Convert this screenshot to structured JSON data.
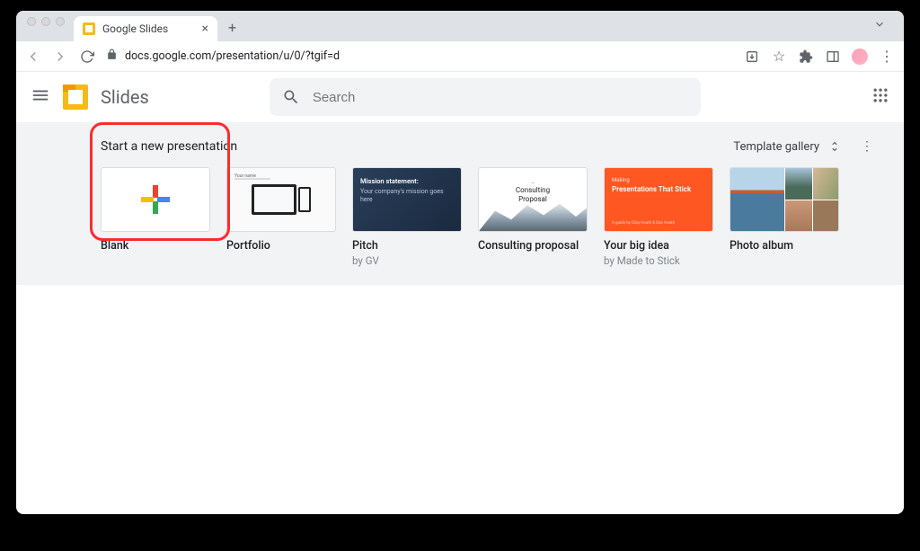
{
  "browser": {
    "tab_title": "Google Slides",
    "url": "docs.google.com/presentation/u/0/?tgif=d"
  },
  "app": {
    "name": "Slides",
    "search_placeholder": "Search"
  },
  "section": {
    "title": "Start a new presentation",
    "gallery_label": "Template gallery"
  },
  "templates": [
    {
      "title": "Blank",
      "sub": ""
    },
    {
      "title": "Portfolio",
      "sub": ""
    },
    {
      "title": "Pitch",
      "sub": "by GV",
      "thumb_line1": "Mission statement:",
      "thumb_line2": "Your company's mission goes here"
    },
    {
      "title": "Consulting proposal",
      "sub": "",
      "thumb_line1": "Consulting",
      "thumb_line2": "Proposal"
    },
    {
      "title": "Your big idea",
      "sub": "by Made to Stick",
      "thumb_tag": "Making",
      "thumb_line1": "Presentations That Stick",
      "thumb_byline": "A guide by Chip Heath & Dan Heath"
    },
    {
      "title": "Photo album",
      "sub": ""
    }
  ]
}
